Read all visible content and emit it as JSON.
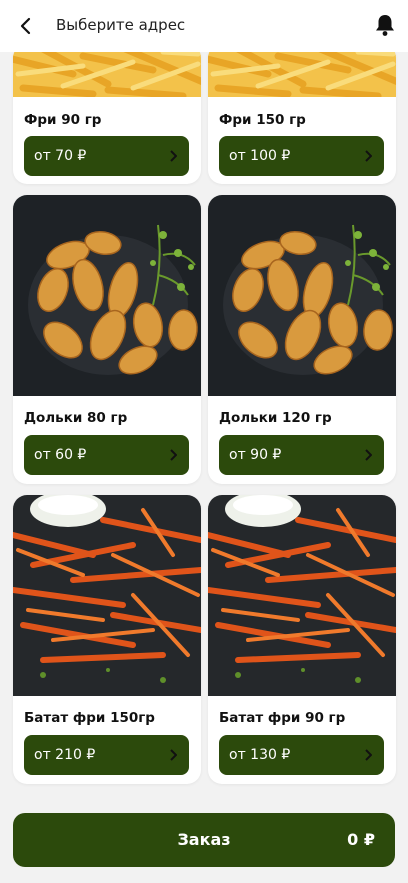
{
  "header": {
    "title": "Выберите адрес",
    "back_icon": "chevron-left-icon",
    "notify_icon": "bell-icon"
  },
  "products": [
    {
      "name": "Фри 90 гр",
      "price": "от 70 ₽",
      "image": "fries"
    },
    {
      "name": "Фри 150 гр",
      "price": "от 100 ₽",
      "image": "fries"
    },
    {
      "name": "Дольки 80 гр",
      "price": "от 60 ₽",
      "image": "potato-wedges"
    },
    {
      "name": "Дольки 120 гр",
      "price": "от 90 ₽",
      "image": "potato-wedges"
    },
    {
      "name": "Батат фри 150гр",
      "price": "от 210 ₽",
      "image": "sweet-potato-fries"
    },
    {
      "name": "Батат фри 90 гр",
      "price": "от 130 ₽",
      "image": "sweet-potato-fries"
    }
  ],
  "order": {
    "label": "Заказ",
    "total": "0 ₽"
  },
  "colors": {
    "accent": "#2c4a0c",
    "background": "#f2f2f2",
    "card": "#ffffff"
  }
}
